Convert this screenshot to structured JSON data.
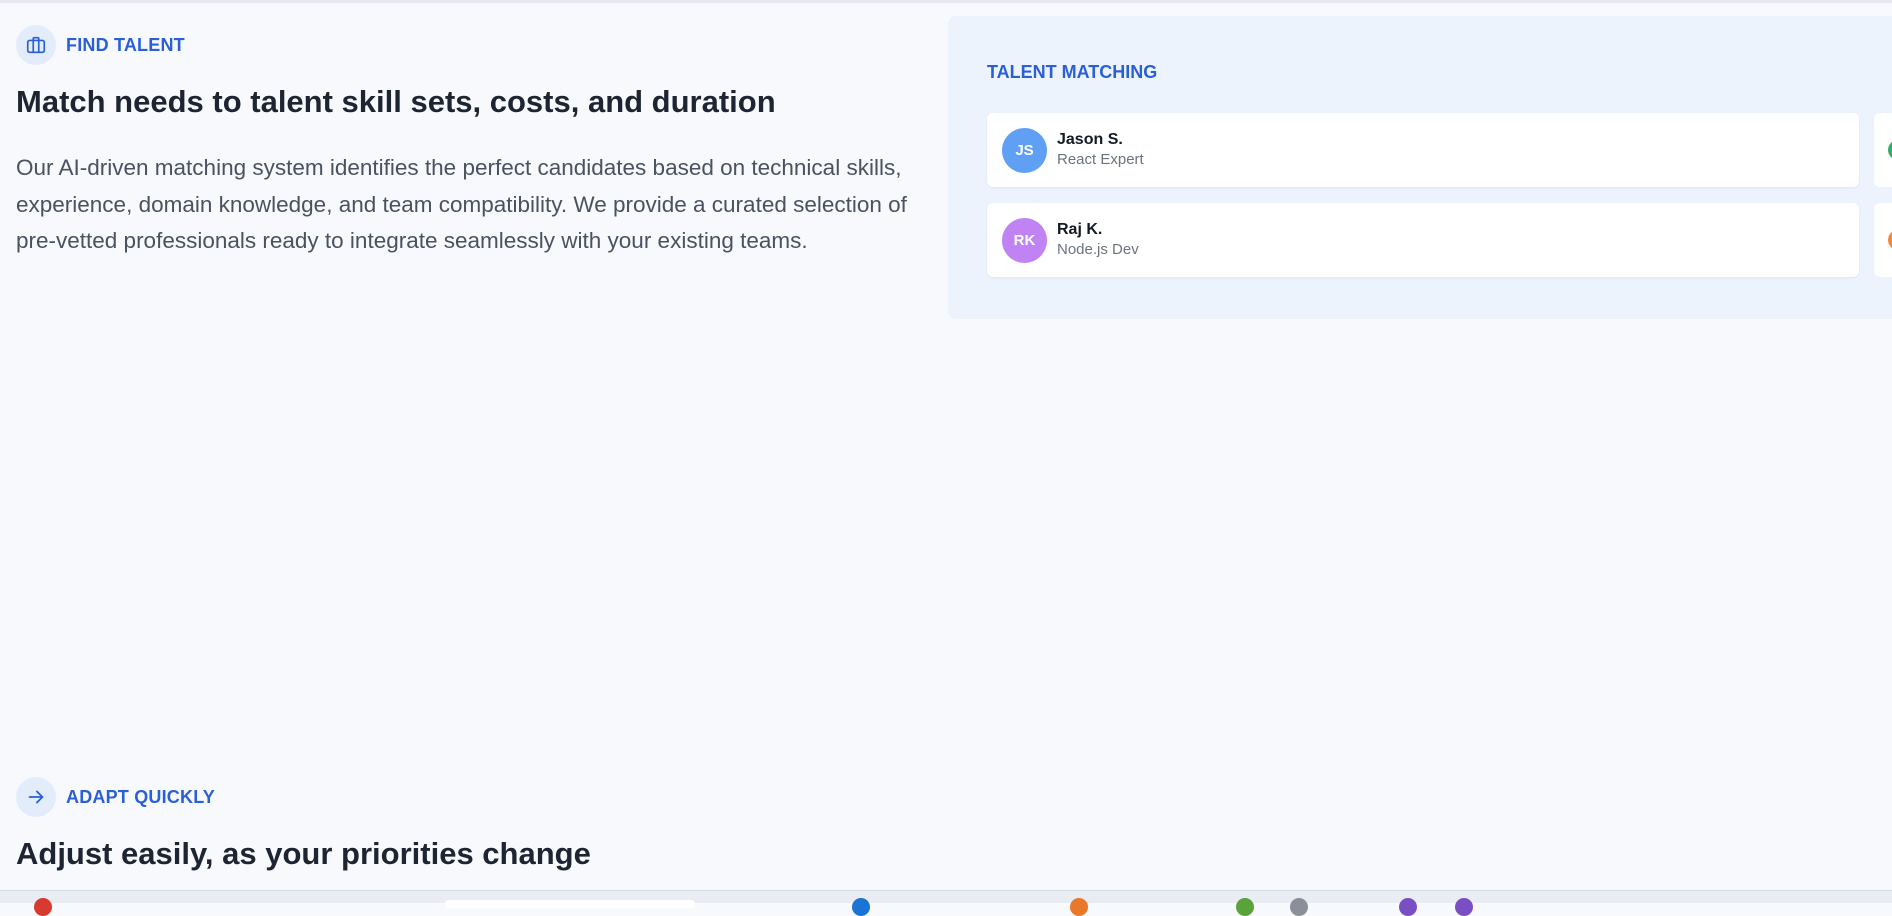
{
  "section_find_talent": {
    "eyebrow": "FIND TALENT",
    "eyebrow_icon": "briefcase-icon",
    "heading": "Match needs to talent skill sets, costs, and duration",
    "paragraph": "Our AI-driven matching system identifies the perfect candidates based on technical skills, experience, domain knowledge, and team compatibility. We provide a curated selection of pre-vetted professionals ready to integrate seamlessly with your existing teams."
  },
  "talent_panel": {
    "title": "TALENT MATCHING",
    "candidates": [
      {
        "initials": "JS",
        "name": "Jason S.",
        "role": "React Expert",
        "avatar_color": "#60a0f4"
      },
      {
        "initials": "RK",
        "name": "Raj K.",
        "role": "Node.js Dev",
        "avatar_color": "#c182f4"
      }
    ]
  },
  "section_adapt": {
    "eyebrow": "ADAPT QUICKLY",
    "eyebrow_icon": "arrow-right-icon",
    "heading": "Adjust easily, as your priorities change"
  },
  "colors": {
    "accent": "#2a5fd6",
    "page_bg": "#f7f9fc",
    "panel_bg": "#edf3fc"
  }
}
